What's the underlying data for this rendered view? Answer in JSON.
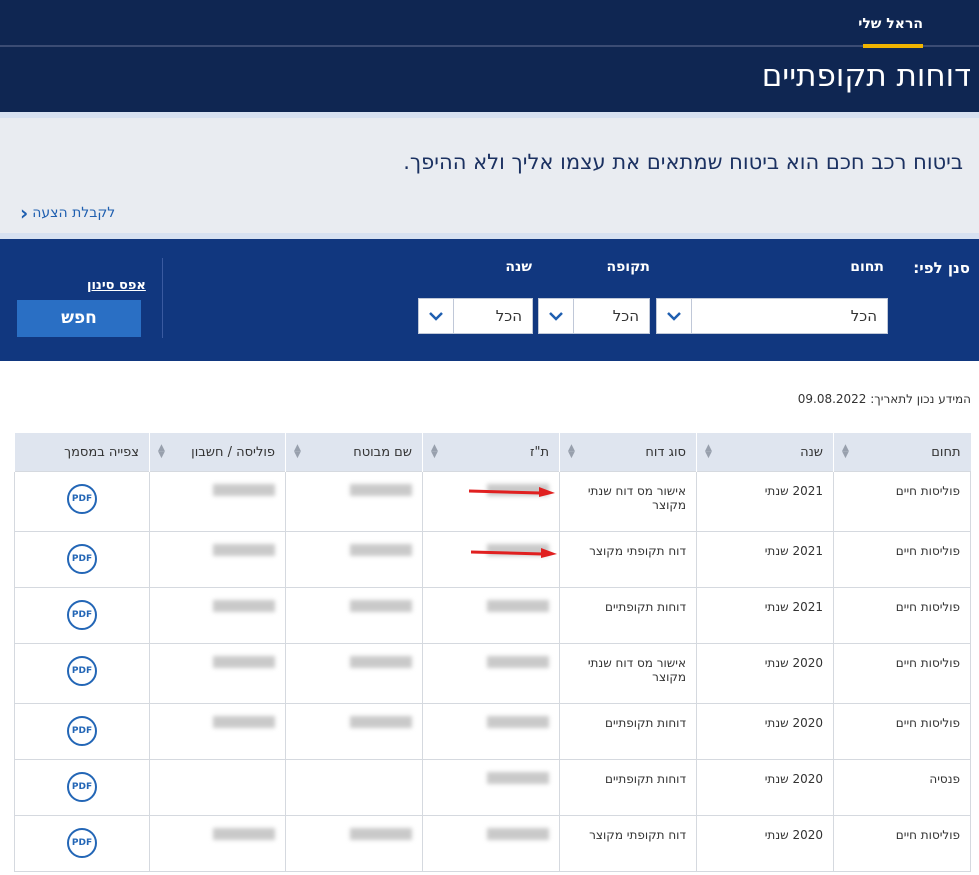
{
  "header": {
    "tab": "הראל שלי",
    "title": "דוחות תקופתיים"
  },
  "promo": {
    "text": "ביטוח רכב חכם הוא ביטוח שמתאים את עצמו אליך ולא ההיפך.",
    "link": "לקבלת הצעה"
  },
  "filter": {
    "sort_by": "סנן לפי:",
    "fields": [
      {
        "label": "תחום",
        "value": "הכל"
      },
      {
        "label": "תקופה",
        "value": "הכל"
      },
      {
        "label": "שנה",
        "value": "הכל"
      }
    ],
    "reset": "אפס סינון",
    "search": "חפש"
  },
  "as_of": "המידע נכון לתאריך: 09.08.2022",
  "table": {
    "columns": [
      "תחום",
      "שנה",
      "סוג דוח",
      "ת\"ז",
      "שם מבוטח",
      "פוליסה / חשבון",
      "צפייה במסמך"
    ],
    "pdf_label": "PDF",
    "rows": [
      {
        "domain": "פוליסות חיים",
        "year": "2021 שנתי",
        "type": "אישור מס דוח שנתי מקוצר"
      },
      {
        "domain": "פוליסות חיים",
        "year": "2021 שנתי",
        "type": "דוח תקופתי מקוצר"
      },
      {
        "domain": "פוליסות חיים",
        "year": "2021 שנתי",
        "type": "דוחות תקופתיים"
      },
      {
        "domain": "פוליסות חיים",
        "year": "2020 שנתי",
        "type": "אישור מס דוח שנתי מקוצר"
      },
      {
        "domain": "פוליסות חיים",
        "year": "2020 שנתי",
        "type": "דוחות תקופתיים"
      },
      {
        "domain": "פנסיה",
        "year": "2020 שנתי",
        "type": "דוחות תקופתיים"
      },
      {
        "domain": "פוליסות חיים",
        "year": "2020 שנתי",
        "type": "דוח תקופתי מקוצר"
      }
    ]
  },
  "colors": {
    "navy": "#0f2652",
    "filter_blue": "#11377f",
    "accent": "#f0b400",
    "button": "#2a6fc4",
    "annotation_red": "#e02020"
  }
}
